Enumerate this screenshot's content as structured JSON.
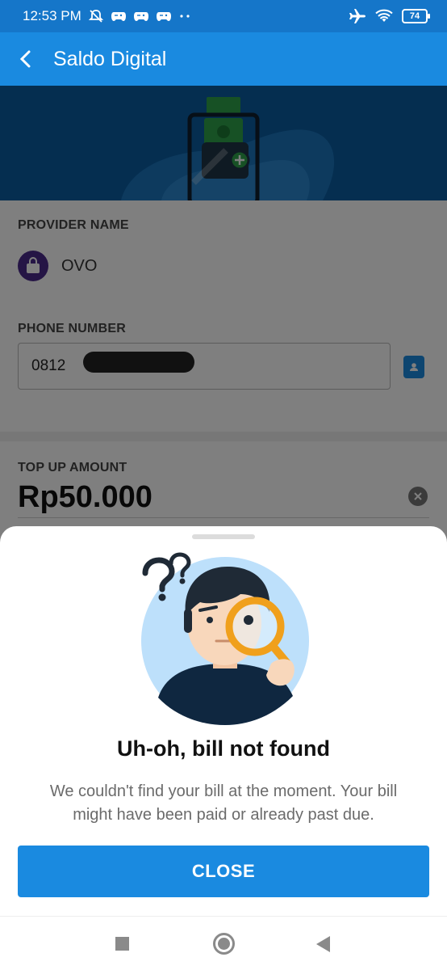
{
  "status_bar": {
    "time": "12:53 PM",
    "battery": "74",
    "icons": [
      "mute-icon",
      "game-controller-icon",
      "game-controller-icon",
      "game-controller-icon",
      "more-dots-icon",
      "airplane-icon",
      "wifi-icon",
      "battery-icon"
    ]
  },
  "app_bar": {
    "title": "Saldo Digital"
  },
  "form": {
    "provider_label": "PROVIDER NAME",
    "provider_name": "OVO",
    "phone_label": "PHONE NUMBER",
    "phone_value": "0812",
    "topup_label": "TOP UP AMOUNT",
    "amount": "Rp50.000"
  },
  "sheet": {
    "title": "Uh-oh, bill not found",
    "description": "We couldn't find your bill at the moment. Your bill might have been paid or already past due.",
    "close_label": "CLOSE"
  },
  "colors": {
    "primary": "#1a8ae0",
    "status_bar": "#1576c9",
    "banner": "#0a5ca0",
    "provider_brand": "#4b2a8a"
  }
}
